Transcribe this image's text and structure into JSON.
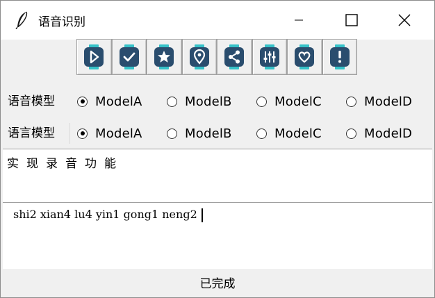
{
  "window": {
    "title": "语音识别",
    "icons": {
      "app": "feather-icon",
      "minimize": "minimize-icon",
      "maximize": "maximize-icon",
      "close": "close-icon"
    }
  },
  "toolbar": {
    "accent_color": "#2a4d6e",
    "trim_color": "#36c2c8",
    "buttons": [
      {
        "icon": "play-icon"
      },
      {
        "icon": "check-icon"
      },
      {
        "icon": "star-icon"
      },
      {
        "icon": "location-pin-icon"
      },
      {
        "icon": "share-icon"
      },
      {
        "icon": "equalizer-icon"
      },
      {
        "icon": "heart-icon"
      },
      {
        "icon": "alert-icon"
      }
    ]
  },
  "model_rows": [
    {
      "label": "语音模型",
      "options": [
        "ModelA",
        "ModelB",
        "ModelC",
        "ModelD"
      ],
      "selected": "ModelA"
    },
    {
      "label": "语言模型",
      "options": [
        "ModelA",
        "ModelB",
        "ModelC",
        "ModelD"
      ],
      "selected": "ModelA"
    }
  ],
  "recognized_text": "实现录音功能",
  "pinyin_text": "shi2 xian4 lu4 yin1 gong1 neng2",
  "status": "已完成"
}
